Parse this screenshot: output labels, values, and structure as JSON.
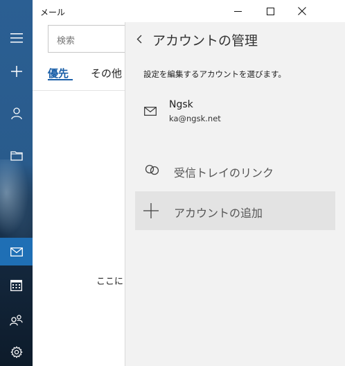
{
  "app": {
    "title": "メール"
  },
  "rail": {
    "items": [
      {
        "name": "menu-icon"
      },
      {
        "name": "plus-icon"
      },
      {
        "name": "person-icon"
      },
      {
        "name": "folder-icon"
      },
      {
        "name": "mail-icon",
        "active": true
      },
      {
        "name": "calendar-icon"
      },
      {
        "name": "people-icon"
      },
      {
        "name": "gear-icon"
      }
    ]
  },
  "mail_pane": {
    "search": {
      "placeholder": "検索"
    },
    "tabs": [
      {
        "label": "優先",
        "selected": true
      },
      {
        "label": "その他"
      }
    ],
    "empty_text": "ここに"
  },
  "flyout": {
    "title": "アカウントの管理",
    "instruction": "設定を編集するアカウントを選びます。",
    "accounts": [
      {
        "name": "Ngsk",
        "email": "ka@ngsk.net"
      }
    ],
    "link_inboxes_label": "受信トレイのリンク",
    "add_account_label": "アカウントの追加"
  },
  "colors": {
    "accent": "#1a5fa8",
    "rail_active": "#1f6fb5",
    "flyout_bg": "#f2f2f2",
    "hover_bg": "#e3e3e3"
  }
}
